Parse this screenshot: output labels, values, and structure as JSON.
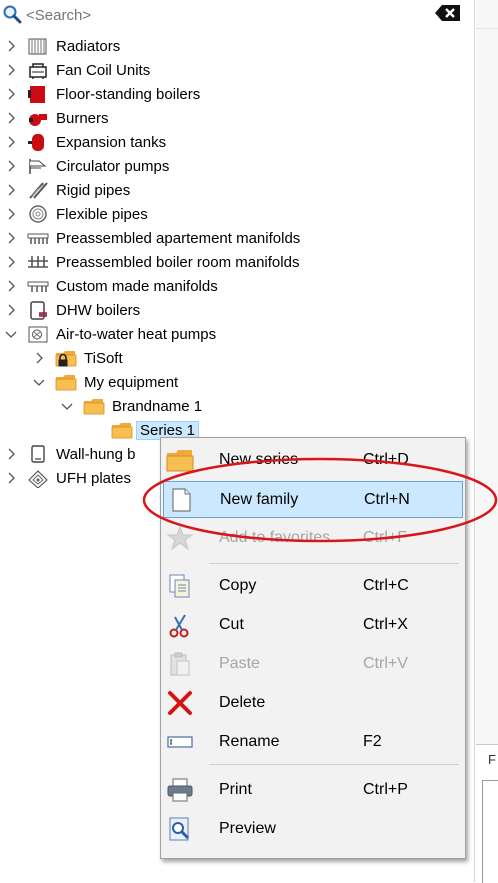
{
  "search": {
    "placeholder": "<Search>"
  },
  "tree": [
    {
      "label": "Radiators",
      "icon": "radiator-icon"
    },
    {
      "label": "Fan Coil Units",
      "icon": "fan-coil-icon"
    },
    {
      "label": "Floor-standing boilers",
      "icon": "floor-boiler-icon"
    },
    {
      "label": "Burners",
      "icon": "burner-icon"
    },
    {
      "label": "Expansion tanks",
      "icon": "expansion-tank-icon"
    },
    {
      "label": "Circulator pumps",
      "icon": "pump-icon"
    },
    {
      "label": "Rigid pipes",
      "icon": "rigid-pipe-icon"
    },
    {
      "label": "Flexible pipes",
      "icon": "flexible-pipe-icon"
    },
    {
      "label": "Preassembled apartement manifolds",
      "icon": "manifold-icon"
    },
    {
      "label": "Preassembled boiler room manifolds",
      "icon": "boiler-room-manifold-icon"
    },
    {
      "label": "Custom made manifolds",
      "icon": "custom-manifold-icon"
    },
    {
      "label": "DHW boilers",
      "icon": "dhw-boiler-icon"
    },
    {
      "label": "Air-to-water heat pumps",
      "icon": "heat-pump-icon"
    },
    {
      "label": "TiSoft",
      "icon": "locked-folder-icon"
    },
    {
      "label": "My equipment",
      "icon": "folder-icon"
    },
    {
      "label": "Brandname 1",
      "icon": "folder-icon"
    },
    {
      "label": "Series 1",
      "icon": "folder-icon"
    },
    {
      "label": "Wall-hung b",
      "icon": "wall-boiler-icon"
    },
    {
      "label": "UFH plates",
      "icon": "ufh-plate-icon"
    }
  ],
  "menu": {
    "items": [
      {
        "label": "New series",
        "shortcut": "Ctrl+D",
        "icon": "folder-icon",
        "state": "normal"
      },
      {
        "label": "New family",
        "shortcut": "Ctrl+N",
        "icon": "document-icon",
        "state": "highlighted"
      },
      {
        "label": "Add to favorites",
        "shortcut": "Ctrl+F",
        "icon": "star-icon",
        "state": "disabled"
      },
      {
        "label": "Copy",
        "shortcut": "Ctrl+C",
        "icon": "copy-icon",
        "state": "normal"
      },
      {
        "label": "Cut",
        "shortcut": "Ctrl+X",
        "icon": "scissors-icon",
        "state": "normal"
      },
      {
        "label": "Paste",
        "shortcut": "Ctrl+V",
        "icon": "paste-icon",
        "state": "disabled"
      },
      {
        "label": "Delete",
        "shortcut": "",
        "icon": "delete-x-icon",
        "state": "normal"
      },
      {
        "label": "Rename",
        "shortcut": "F2",
        "icon": "rename-icon",
        "state": "normal"
      },
      {
        "label": "Print",
        "shortcut": "Ctrl+P",
        "icon": "printer-icon",
        "state": "normal"
      },
      {
        "label": "Preview",
        "shortcut": "",
        "icon": "preview-icon",
        "state": "normal"
      }
    ]
  },
  "right_panel": {
    "tab_label": "F"
  },
  "colors": {
    "selection": "#cce8ff",
    "annotation": "#d9141a",
    "folder": "#f6b93b"
  }
}
